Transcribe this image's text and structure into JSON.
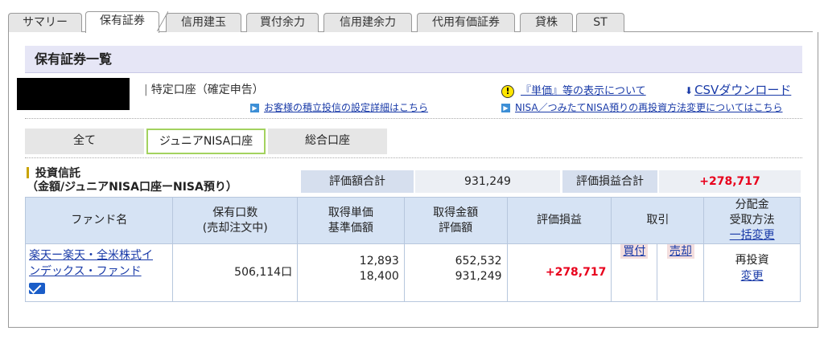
{
  "tabs": [
    "サマリー",
    "保有証券",
    "信用建玉",
    "買付余力",
    "信用建余力",
    "代用有価証券",
    "貸株",
    "ST"
  ],
  "header": {
    "title": "保有証券一覧"
  },
  "account": {
    "type": "特定口座（確定申告）"
  },
  "links": {
    "tsumitate": "お客様の積立投信の設定詳細はこちら",
    "unit_price_note": "『単価』等の表示について",
    "csv": "CSVダウンロード",
    "nisa_reinvest": "NISA／つみたてNISA預りの再投資方法変更についてはこちら"
  },
  "segments": [
    "全て",
    "ジュニアNISA口座",
    "総合口座"
  ],
  "section": {
    "title_line1": "投資信託",
    "title_line2": "（金額/ジュニアNISA口座ーNISA預り）"
  },
  "summary": {
    "valuation_label": "評価額合計",
    "valuation_value": "931,249",
    "pl_label": "評価損益合計",
    "pl_value": "+278,717"
  },
  "table": {
    "headers": {
      "fund": "ファンド名",
      "units_1": "保有口数",
      "units_2": "(売却注文中)",
      "unit_1": "取得単価",
      "unit_2": "基準価額",
      "amount_1": "取得金額",
      "amount_2": "評価額",
      "pl": "評価損益",
      "trade": "取引",
      "dist_1": "分配金",
      "dist_2": "受取方法",
      "dist_3": "一括変更"
    },
    "row": {
      "fund_line1": "楽天ー楽天・全米株式イ",
      "fund_line2": "ンデックス・ファンド",
      "units": "506,114口",
      "acq_unit": "12,893",
      "base_price": "18,400",
      "acq_amount": "652,532",
      "valuation": "931,249",
      "pl": "+278,717",
      "buy": "買付",
      "sell": "売却",
      "dist_method": "再投資",
      "dist_change": "変更"
    }
  },
  "colors": {
    "accent_red": "#e8001c",
    "link_blue": "#1a3ba8",
    "selected_border": "#a3d25f"
  }
}
